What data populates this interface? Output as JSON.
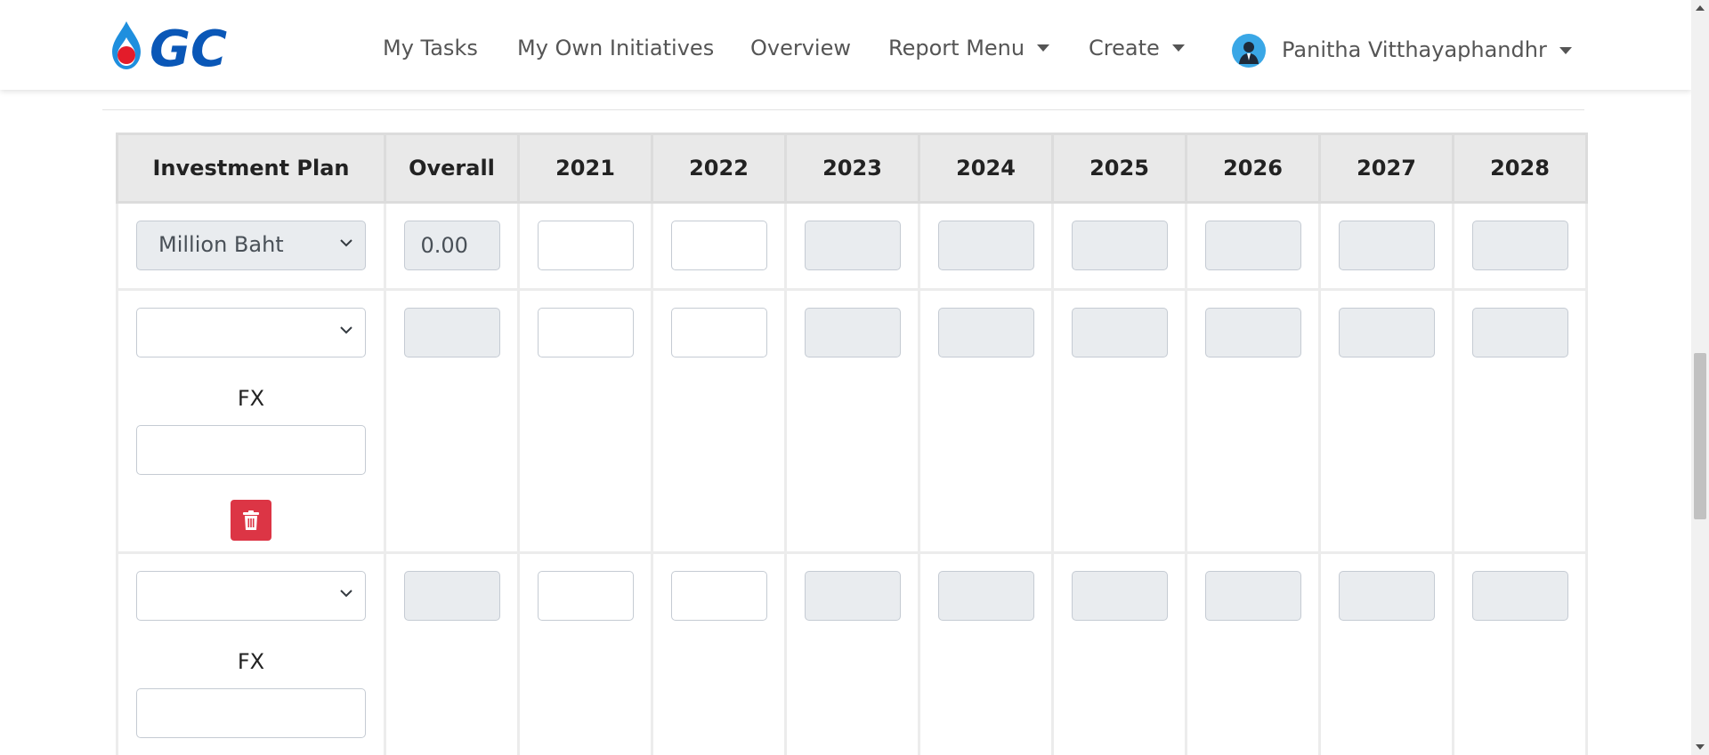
{
  "nav": {
    "logo_text": "GC",
    "items": [
      {
        "label": "My Tasks"
      },
      {
        "label": "My Own Initiatives"
      },
      {
        "label": "Overview"
      },
      {
        "label": "Report Menu"
      },
      {
        "label": "Create"
      }
    ],
    "user_name": "Panitha Vitthayaphandhr"
  },
  "table": {
    "headers": [
      "Investment Plan",
      "Overall",
      "2021",
      "2022",
      "2023",
      "2024",
      "2025",
      "2026",
      "2027",
      "2028"
    ],
    "row1": {
      "currency": "Million Baht",
      "overall": "0.00"
    },
    "fx_label": "FX"
  },
  "colors": {
    "brand_blue": "#0a57b7",
    "danger": "#dc3545",
    "avatar_bg": "#3aa7e6"
  },
  "icons": [
    "logo-icon",
    "avatar-icon",
    "chevron-down-icon",
    "trash-icon"
  ]
}
